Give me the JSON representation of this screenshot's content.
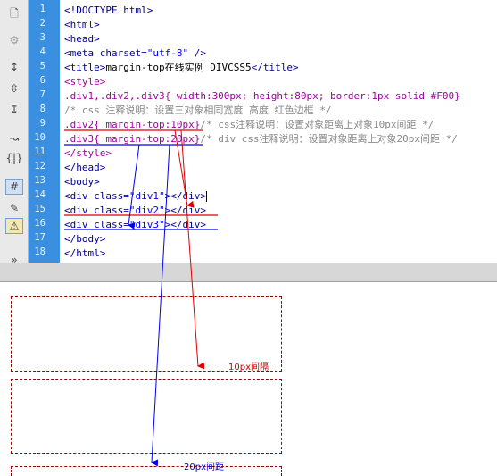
{
  "toolbar": {
    "icons": [
      "file-icon",
      "gear-icon",
      "expand-icon",
      "collapse-icon",
      "select-tag-icon",
      "wrap-tag-icon",
      "braces-icon",
      "line-numbers-icon",
      "highlight-icon",
      "format-icon",
      "more-icon"
    ]
  },
  "line_numbers": [
    "1",
    "2",
    "3",
    "4",
    "5",
    "6",
    "7",
    "8",
    "9",
    "10",
    "11",
    "12",
    "13",
    "14",
    "15",
    "16",
    "17",
    "18"
  ],
  "code": {
    "l1": "<!DOCTYPE html>",
    "l2": "<html>",
    "l3": "<head>",
    "l4a": "<meta charset=",
    "l4b": "\"utf-8\"",
    "l4c": " />",
    "l5a": "<title>",
    "l5b": "margin-top在线实例 DIVCSS5",
    "l5c": "</title>",
    "l6": "<style>",
    "l7": ".div1,.div2,.div3{ width:300px; height:80px; border:1px solid #F00}",
    "l8": "/* css 注释说明：设置三对象相同宽度 高度 红色边框 */",
    "l9a": ".div2{ margin-top:10px}",
    "l9b": "/* css注释说明：设置对象距离上对象10px间距 */",
    "l10a": ".div3{ margin-top:20px}",
    "l10b": "/* div css注释说明：设置对象距离上对象20px间距 */",
    "l11": "</style>",
    "l12": "</head>",
    "l13": "<body>",
    "l14a": "<div class=",
    "l14b": "\"div1\"",
    "l14c": "></div>",
    "l15a": "<div class=",
    "l15b": "\"div2\"",
    "l15c": "></div>",
    "l16a": "<div class=",
    "l16b": "\"div3\"",
    "l16c": "></div>",
    "l17": "</body>",
    "l18": "</html>"
  },
  "preview": {
    "gap_10_label": "10px间隔",
    "gap_20_label": "20px间距"
  },
  "colors": {
    "gutter": "#3b8fe0",
    "border": "#990000",
    "arrow_red": "#dd0000",
    "arrow_blue": "#0000ee"
  }
}
